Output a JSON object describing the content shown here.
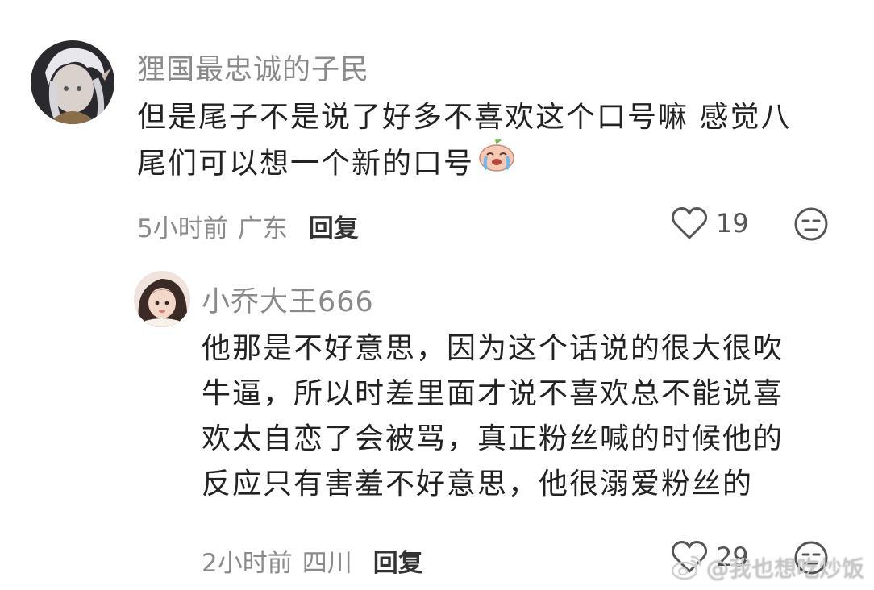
{
  "comments": [
    {
      "username": "狸国最忠诚的子民",
      "lines": [
        "但是尾子不是说了好多不喜欢这个口号嘛 感觉八",
        "尾们可以想一个新的口号"
      ],
      "emoji": "crying-peach-emoji",
      "time": "5小时前",
      "location": "广东",
      "reply_label": "回复",
      "likes": "19"
    },
    {
      "username": "小乔大王666",
      "lines": [
        "他那是不好意思，因为这个话说的很大很吹",
        "牛逼，所以时差里面才说不喜欢总不能说喜",
        "欢太自恋了会被骂，真正粉丝喊的时候他的",
        "反应只有害羞不好意思，他很溺爱粉丝的"
      ],
      "time": "2小时前",
      "location": "四川",
      "reply_label": "回复",
      "likes": "29"
    }
  ],
  "watermark": {
    "text": "@我也想吃炒饭",
    "icon": "weibo-logo-icon"
  },
  "colors": {
    "username": "#8a8a8a",
    "text": "#222222",
    "meta": "#8a8a8a"
  }
}
